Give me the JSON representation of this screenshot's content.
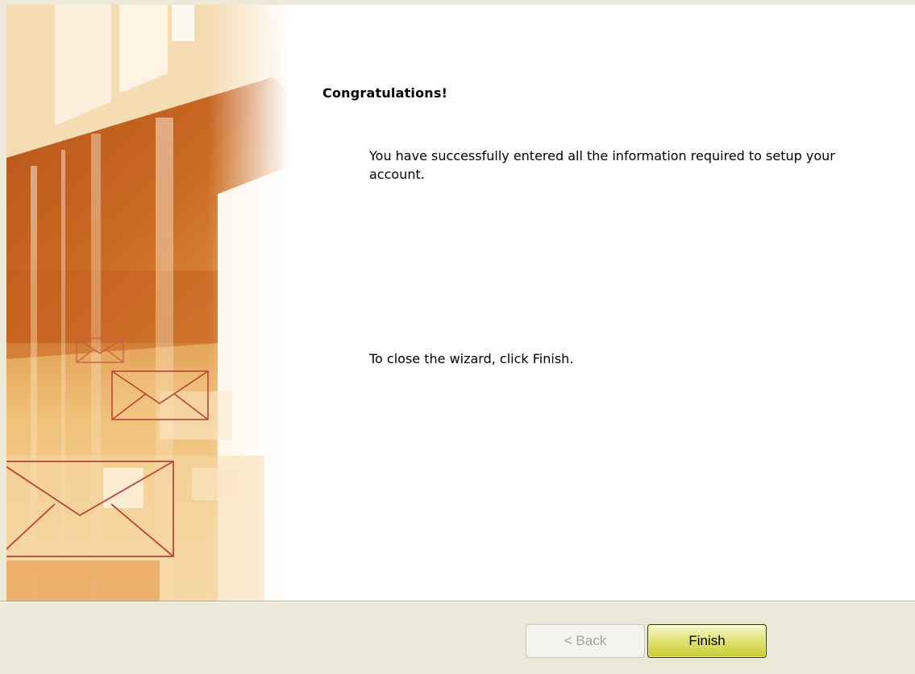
{
  "wizard": {
    "heading": "Congratulations!",
    "message": "You have successfully entered all the information required to setup your account.",
    "close_hint": "To close the wizard, click Finish."
  },
  "buttons": {
    "back_label": "< Back",
    "finish_label": "Finish",
    "back_enabled": false
  },
  "colors": {
    "banner_accent": "#c9621c",
    "envelope_outline": "#b94a3c",
    "finish_button": "#dfe06a"
  },
  "icons": [
    "envelope-icon",
    "envelope-icon",
    "envelope-icon"
  ]
}
